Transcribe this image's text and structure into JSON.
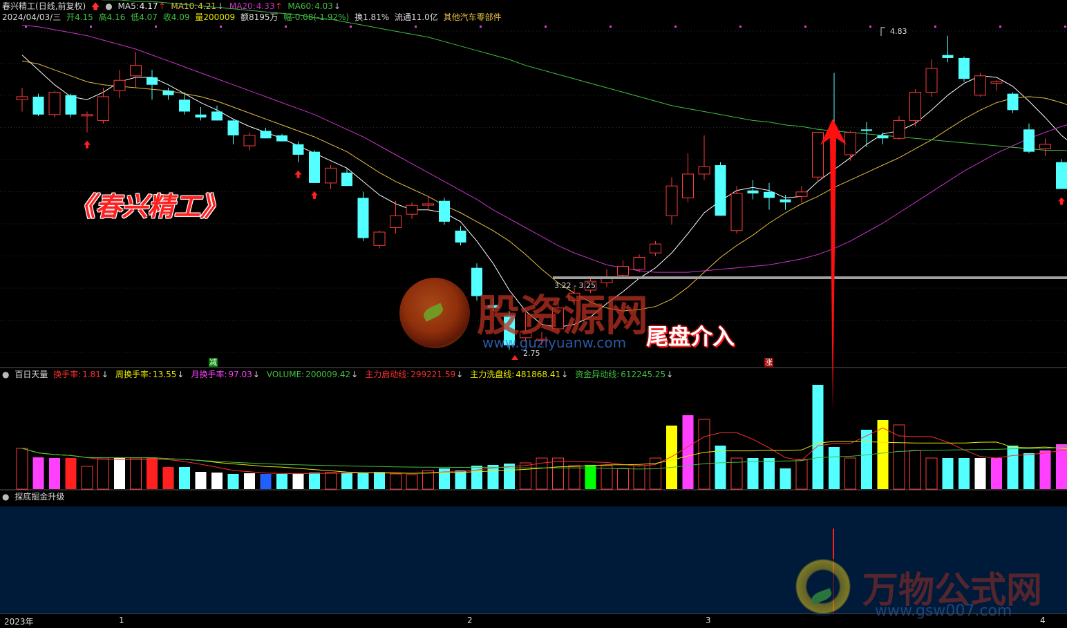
{
  "header": {
    "stock": "春兴精工",
    "mode": "(日线,前复权)",
    "ma5_label": "MA5:",
    "ma5": "4.17",
    "ma10_label": "MA10:",
    "ma10": "4.21",
    "ma20_label": "MA20:",
    "ma20": "4.33",
    "ma60_label": "MA60:",
    "ma60": "4.03",
    "date": "2024/04/03/三",
    "open_label": "开",
    "open": "4.15",
    "high_label": "高",
    "high": "4.16",
    "low_label": "低",
    "low": "4.07",
    "close_label": "收",
    "close": "4.09",
    "vol_label": "量",
    "vol": "200009",
    "amount_label": "额",
    "amount": "8195万",
    "chg_label": "幅",
    "chg": "-0.08(-1.92%)",
    "turnover_label": "换",
    "turnover": "1.81%",
    "float_label": "流通",
    "float": "11.0亿",
    "sector": "其他汽车零部件"
  },
  "indicator1": {
    "name": "百日天量",
    "items": [
      {
        "label": "换手率:",
        "value": "1.81",
        "color": "#ff3030",
        "arrow": "↓"
      },
      {
        "label": "周换手率:",
        "value": "13.55",
        "color": "#e8e800",
        "arrow": "↓"
      },
      {
        "label": "月换手率:",
        "value": "97.03",
        "color": "#ff40ff",
        "arrow": "↓"
      },
      {
        "label": "VOLUME:",
        "value": "200009.42",
        "color": "#40c040",
        "arrow": "↓"
      },
      {
        "label": "主力启动线:",
        "value": "299221.59",
        "color": "#ff3030",
        "arrow": "↓"
      },
      {
        "label": "主力洗盘线:",
        "value": "481868.41",
        "color": "#e8e800",
        "arrow": "↓"
      },
      {
        "label": "资金异动线:",
        "value": "612245.25",
        "color": "#40c040",
        "arrow": "↓"
      }
    ]
  },
  "indicator2": {
    "name": "探底掘金升级"
  },
  "annotations": {
    "title": "《春兴精工》",
    "tail_text": "尾盘介入",
    "high_mark": "4.83",
    "low_mark": "2.75",
    "range_mark": "3.22 - 3.25",
    "reduce_mark": "减",
    "rise_mark": "涨"
  },
  "watermarks": {
    "w1_cn": "股资源网",
    "w1_url": "www.guziyuanw.com",
    "w2_cn": "万物公式网",
    "w2_url": "www.gsw007.com"
  },
  "time_axis": {
    "labels": [
      "2023年",
      "1",
      "2",
      "3",
      "4"
    ]
  },
  "colors": {
    "up": "#ff3b3b",
    "down": "#54ffff",
    "ma5": "#ffffff",
    "ma10": "#e8c040",
    "ma20": "#cc33cc",
    "ma60": "#40c040",
    "panel2_bg": "#001a3a"
  },
  "chart_data": {
    "type": "candlestick",
    "price_range": [
      2.7,
      4.9
    ],
    "candles": [
      {
        "o": 4.4,
        "h": 4.48,
        "l": 4.32,
        "c": 4.42
      },
      {
        "o": 4.42,
        "h": 4.44,
        "l": 4.29,
        "c": 4.3
      },
      {
        "o": 4.3,
        "h": 4.46,
        "l": 4.28,
        "c": 4.45
      },
      {
        "o": 4.43,
        "h": 4.44,
        "l": 4.28,
        "c": 4.3
      },
      {
        "o": 4.3,
        "h": 4.32,
        "l": 4.18,
        "c": 4.3
      },
      {
        "o": 4.26,
        "h": 4.48,
        "l": 4.24,
        "c": 4.42
      },
      {
        "o": 4.46,
        "h": 4.6,
        "l": 4.41,
        "c": 4.53
      },
      {
        "o": 4.56,
        "h": 4.72,
        "l": 4.48,
        "c": 4.63
      },
      {
        "o": 4.55,
        "h": 4.6,
        "l": 4.4,
        "c": 4.5
      },
      {
        "o": 4.46,
        "h": 4.48,
        "l": 4.4,
        "c": 4.43
      },
      {
        "o": 4.4,
        "h": 4.45,
        "l": 4.3,
        "c": 4.32
      },
      {
        "o": 4.3,
        "h": 4.35,
        "l": 4.26,
        "c": 4.28
      },
      {
        "o": 4.32,
        "h": 4.36,
        "l": 4.26,
        "c": 4.26
      },
      {
        "o": 4.26,
        "h": 4.27,
        "l": 4.1,
        "c": 4.16
      },
      {
        "o": 4.09,
        "h": 4.18,
        "l": 4.06,
        "c": 4.16
      },
      {
        "o": 4.19,
        "h": 4.21,
        "l": 4.14,
        "c": 4.14
      },
      {
        "o": 4.16,
        "h": 4.17,
        "l": 4.12,
        "c": 4.12
      },
      {
        "o": 4.1,
        "h": 4.12,
        "l": 3.98,
        "c": 4.03
      },
      {
        "o": 4.05,
        "h": 4.06,
        "l": 3.84,
        "c": 3.84
      },
      {
        "o": 3.84,
        "h": 3.96,
        "l": 3.8,
        "c": 3.94
      },
      {
        "o": 3.91,
        "h": 3.94,
        "l": 3.82,
        "c": 3.82
      },
      {
        "o": 3.74,
        "h": 3.78,
        "l": 3.45,
        "c": 3.47
      },
      {
        "o": 3.42,
        "h": 3.52,
        "l": 3.4,
        "c": 3.51
      },
      {
        "o": 3.54,
        "h": 3.72,
        "l": 3.5,
        "c": 3.62
      },
      {
        "o": 3.63,
        "h": 3.71,
        "l": 3.6,
        "c": 3.69
      },
      {
        "o": 3.7,
        "h": 3.75,
        "l": 3.66,
        "c": 3.7
      },
      {
        "o": 3.72,
        "h": 3.74,
        "l": 3.56,
        "c": 3.58
      },
      {
        "o": 3.52,
        "h": 3.55,
        "l": 3.42,
        "c": 3.44
      },
      {
        "o": 3.27,
        "h": 3.3,
        "l": 3.05,
        "c": 3.08
      },
      {
        "o": 3.02,
        "h": 3.07,
        "l": 2.98,
        "c": 3.0
      },
      {
        "o": 2.95,
        "h": 2.98,
        "l": 2.72,
        "c": 2.75
      },
      {
        "o": 2.8,
        "h": 2.97,
        "l": 2.78,
        "c": 2.84
      },
      {
        "o": 2.78,
        "h": 2.84,
        "l": 2.75,
        "c": 2.79
      },
      {
        "o": 2.86,
        "h": 3.06,
        "l": 2.84,
        "c": 3.0
      },
      {
        "o": 3.05,
        "h": 3.14,
        "l": 3.02,
        "c": 3.1
      },
      {
        "o": 3.12,
        "h": 3.2,
        "l": 3.1,
        "c": 3.18
      },
      {
        "o": 3.17,
        "h": 3.26,
        "l": 3.14,
        "c": 3.21
      },
      {
        "o": 3.22,
        "h": 3.32,
        "l": 3.2,
        "c": 3.28
      },
      {
        "o": 3.26,
        "h": 3.36,
        "l": 3.24,
        "c": 3.34
      },
      {
        "o": 3.37,
        "h": 3.45,
        "l": 3.35,
        "c": 3.43
      },
      {
        "o": 3.62,
        "h": 3.88,
        "l": 3.56,
        "c": 3.82
      },
      {
        "o": 3.74,
        "h": 4.04,
        "l": 3.71,
        "c": 3.9
      },
      {
        "o": 3.9,
        "h": 4.16,
        "l": 3.86,
        "c": 3.95
      },
      {
        "o": 3.96,
        "h": 3.98,
        "l": 3.62,
        "c": 3.62
      },
      {
        "o": 3.52,
        "h": 3.82,
        "l": 3.5,
        "c": 3.77
      },
      {
        "o": 3.79,
        "h": 3.86,
        "l": 3.73,
        "c": 3.77
      },
      {
        "o": 3.78,
        "h": 3.84,
        "l": 3.66,
        "c": 3.74
      },
      {
        "o": 3.73,
        "h": 3.76,
        "l": 3.66,
        "c": 3.71
      },
      {
        "o": 3.75,
        "h": 3.82,
        "l": 3.71,
        "c": 3.78
      },
      {
        "o": 3.88,
        "h": 4.16,
        "l": 3.85,
        "c": 4.18
      },
      {
        "o": 4.19,
        "h": 4.58,
        "l": 4.16,
        "c": 4.17
      },
      {
        "o": 4.03,
        "h": 4.19,
        "l": 3.99,
        "c": 4.18
      },
      {
        "o": 4.2,
        "h": 4.25,
        "l": 4.08,
        "c": 4.19
      },
      {
        "o": 4.16,
        "h": 4.18,
        "l": 4.1,
        "c": 4.14
      },
      {
        "o": 4.14,
        "h": 4.29,
        "l": 4.13,
        "c": 4.26
      },
      {
        "o": 4.26,
        "h": 4.47,
        "l": 4.22,
        "c": 4.45
      },
      {
        "o": 4.45,
        "h": 4.67,
        "l": 4.42,
        "c": 4.61
      },
      {
        "o": 4.7,
        "h": 4.83,
        "l": 4.65,
        "c": 4.68
      },
      {
        "o": 4.68,
        "h": 4.69,
        "l": 4.52,
        "c": 4.54
      },
      {
        "o": 4.43,
        "h": 4.58,
        "l": 4.42,
        "c": 4.56
      },
      {
        "o": 4.52,
        "h": 4.53,
        "l": 4.46,
        "c": 4.52
      },
      {
        "o": 4.44,
        "h": 4.45,
        "l": 4.31,
        "c": 4.33
      },
      {
        "o": 4.2,
        "h": 4.24,
        "l": 4.04,
        "c": 4.05
      },
      {
        "o": 4.07,
        "h": 4.14,
        "l": 4.02,
        "c": 4.1
      },
      {
        "o": 3.98,
        "h": 4.0,
        "l": 3.8,
        "c": 3.8
      },
      {
        "o": 3.8,
        "h": 4.0,
        "l": 3.74,
        "c": 3.99
      },
      {
        "o": 4.0,
        "h": 4.16,
        "l": 3.98,
        "c": 4.11
      },
      {
        "o": 4.1,
        "h": 4.12,
        "l": 4.07,
        "c": 4.11
      },
      {
        "o": 4.15,
        "h": 4.16,
        "l": 4.07,
        "c": 4.09
      }
    ],
    "series": [
      {
        "name": "MA5",
        "values": [
          4.7,
          4.6,
          4.5,
          4.42,
          4.4,
          4.45,
          4.52,
          4.55,
          4.55,
          4.5,
          4.44,
          4.38,
          4.33,
          4.27,
          4.22,
          4.18,
          4.14,
          4.09,
          4.04,
          3.99,
          3.94,
          3.85,
          3.76,
          3.7,
          3.66,
          3.66,
          3.64,
          3.58,
          3.45,
          3.3,
          3.12,
          2.98,
          2.89,
          2.87,
          2.89,
          2.94,
          3.03,
          3.11,
          3.2,
          3.27,
          3.37,
          3.5,
          3.64,
          3.72,
          3.79,
          3.81,
          3.79,
          3.74,
          3.75,
          3.85,
          3.93,
          4.01,
          4.1,
          4.17,
          4.19,
          4.24,
          4.33,
          4.43,
          4.51,
          4.56,
          4.55,
          4.49,
          4.39,
          4.28,
          4.16,
          4.07,
          4.02,
          4.01,
          4.05
        ]
      },
      {
        "name": "MA10",
        "values": [
          4.66,
          4.64,
          4.6,
          4.56,
          4.52,
          4.5,
          4.49,
          4.48,
          4.47,
          4.46,
          4.44,
          4.42,
          4.39,
          4.35,
          4.31,
          4.27,
          4.23,
          4.19,
          4.15,
          4.1,
          4.05,
          3.98,
          3.91,
          3.85,
          3.8,
          3.75,
          3.69,
          3.64,
          3.58,
          3.52,
          3.45,
          3.36,
          3.26,
          3.17,
          3.1,
          3.04,
          3.0,
          2.98,
          2.99,
          3.01,
          3.06,
          3.14,
          3.24,
          3.34,
          3.42,
          3.49,
          3.57,
          3.64,
          3.7,
          3.75,
          3.81,
          3.86,
          3.91,
          3.96,
          4.01,
          4.07,
          4.13,
          4.2,
          4.27,
          4.33,
          4.38,
          4.41,
          4.42,
          4.41,
          4.38,
          4.34,
          4.29,
          4.24,
          4.21
        ]
      },
      {
        "name": "MA20",
        "values": [
          4.9,
          4.89,
          4.87,
          4.85,
          4.83,
          4.8,
          4.77,
          4.74,
          4.7,
          4.66,
          4.62,
          4.58,
          4.54,
          4.5,
          4.46,
          4.42,
          4.38,
          4.34,
          4.3,
          4.25,
          4.2,
          4.15,
          4.09,
          4.03,
          3.97,
          3.91,
          3.85,
          3.79,
          3.73,
          3.66,
          3.6,
          3.54,
          3.48,
          3.42,
          3.37,
          3.33,
          3.29,
          3.27,
          3.25,
          3.24,
          3.24,
          3.24,
          3.25,
          3.26,
          3.27,
          3.28,
          3.29,
          3.31,
          3.33,
          3.36,
          3.4,
          3.45,
          3.51,
          3.57,
          3.64,
          3.71,
          3.78,
          3.85,
          3.92,
          3.98,
          4.04,
          4.09,
          4.14,
          4.18,
          4.22,
          4.25,
          4.28,
          4.3,
          4.33
        ]
      },
      {
        "name": "MA60",
        "values": [
          5.1,
          5.09,
          5.09,
          5.08,
          5.08,
          5.07,
          5.07,
          5.06,
          5.06,
          5.05,
          5.04,
          5.03,
          5.02,
          5.01,
          5.0,
          4.99,
          4.98,
          4.97,
          4.95,
          4.94,
          4.92,
          4.9,
          4.88,
          4.86,
          4.84,
          4.82,
          4.79,
          4.76,
          4.73,
          4.7,
          4.67,
          4.63,
          4.6,
          4.57,
          4.54,
          4.51,
          4.48,
          4.45,
          4.42,
          4.39,
          4.36,
          4.34,
          4.32,
          4.3,
          4.28,
          4.26,
          4.25,
          4.23,
          4.22,
          4.2,
          4.19,
          4.18,
          4.17,
          4.16,
          4.15,
          4.14,
          4.13,
          4.12,
          4.11,
          4.1,
          4.09,
          4.08,
          4.07,
          4.06,
          4.06,
          4.05,
          4.05,
          4.04,
          4.03
        ]
      }
    ],
    "volume": [
      5.9,
      4.6,
      4.5,
      4.5,
      3.3,
      4.5,
      4.5,
      4.5,
      4.6,
      3.2,
      3.2,
      2.5,
      2.4,
      2.2,
      2.3,
      2.2,
      2.2,
      2.3,
      2.4,
      2.4,
      2.4,
      2.3,
      2.5,
      2.2,
      2.1,
      2.7,
      3.0,
      2.7,
      3.4,
      3.5,
      3.7,
      3.8,
      4.5,
      4.5,
      3.4,
      3.5,
      3.4,
      3.0,
      3.4,
      4.5,
      9.2,
      10.7,
      10.1,
      6.3,
      4.5,
      4.5,
      4.5,
      3.0,
      4.3,
      15.1,
      6.1,
      4.5,
      8.6,
      10.0,
      9.3,
      5.6,
      4.5,
      4.5,
      4.5,
      4.5,
      4.5,
      6.3,
      5.2,
      5.6,
      6.5,
      5.6,
      4.6,
      4.3,
      3.0
    ]
  }
}
